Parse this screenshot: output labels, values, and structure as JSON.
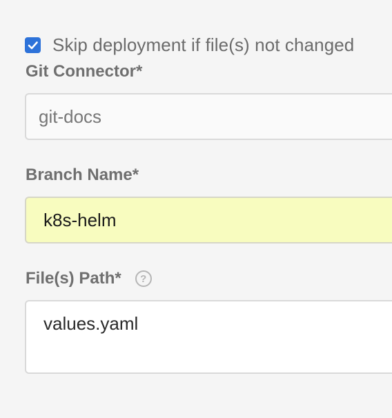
{
  "skip_deployment": {
    "checked": true,
    "label": "Skip deployment if file(s) not changed"
  },
  "git_connector": {
    "label": "Git Connector*",
    "value": "git-docs"
  },
  "branch_name": {
    "label": "Branch Name*",
    "value": "k8s-helm"
  },
  "files_path": {
    "label": "File(s) Path*",
    "help_icon": "?",
    "value": "values.yaml"
  },
  "colors": {
    "checkbox": "#2d72d9",
    "branch_highlight": "#f8fcbf"
  }
}
